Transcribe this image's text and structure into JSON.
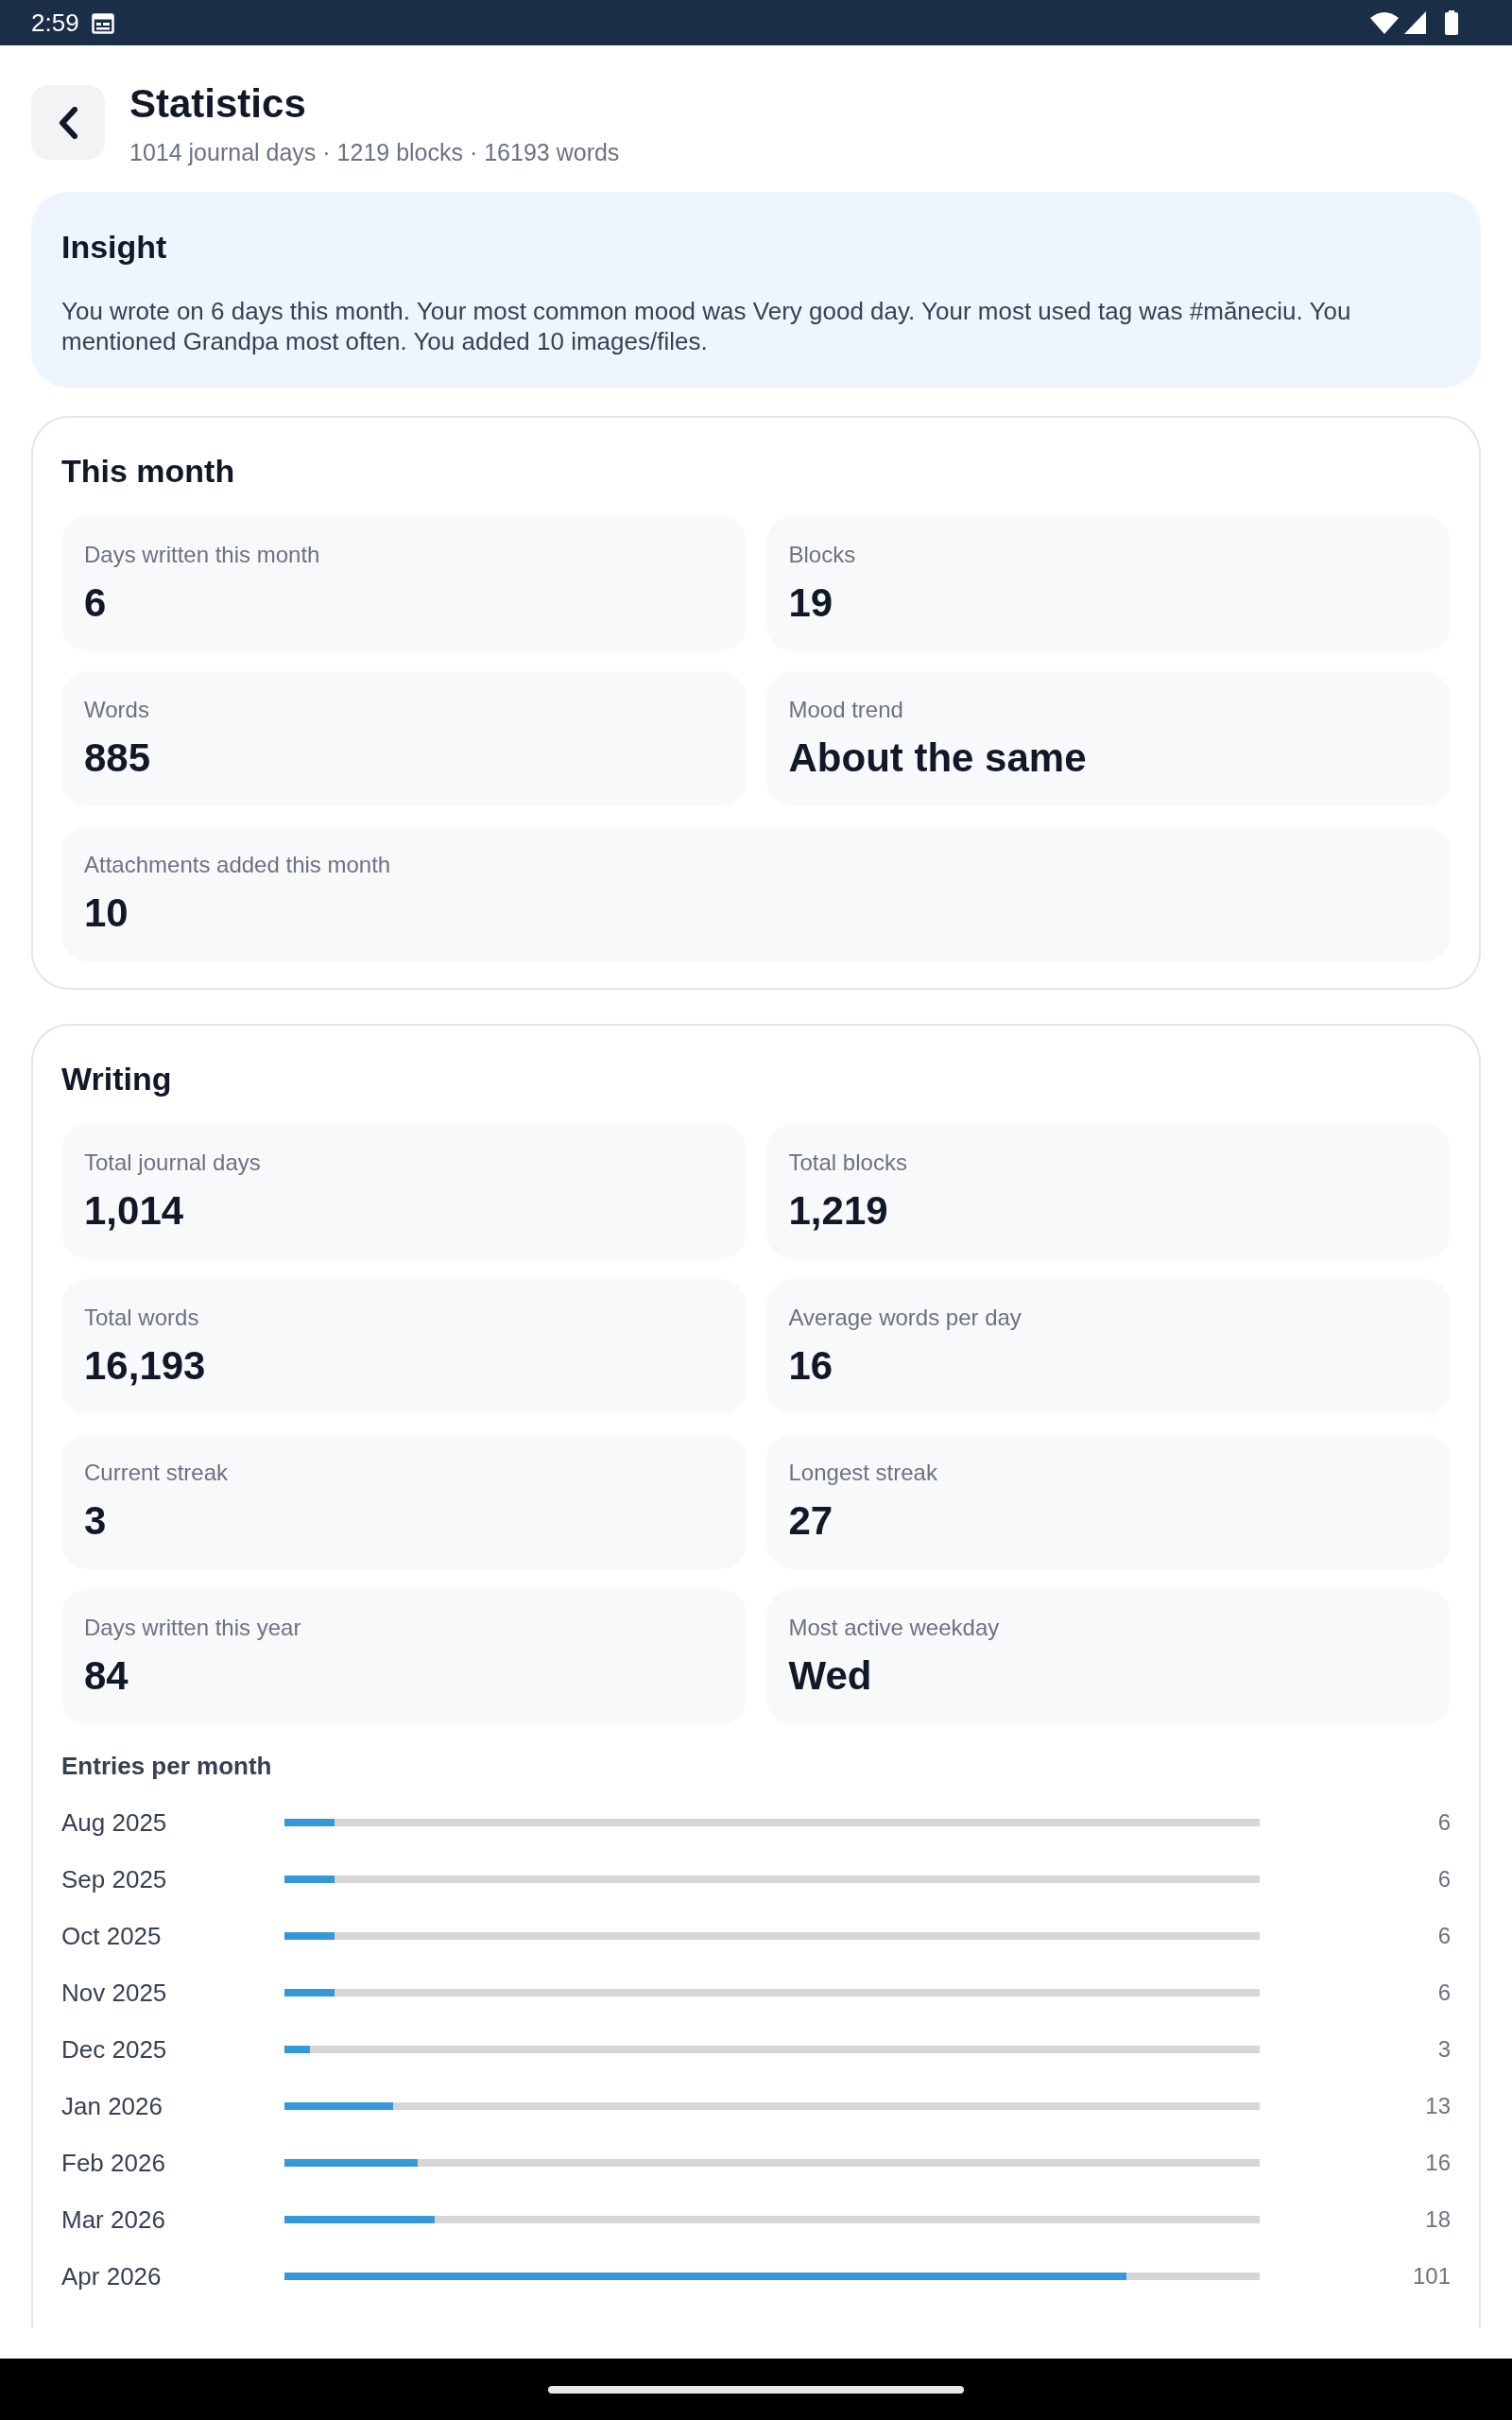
{
  "status_bar": {
    "time": "2:59"
  },
  "header": {
    "title": "Statistics",
    "subtitle": "1014 journal days · 1219 blocks · 16193 words"
  },
  "insight": {
    "title": "Insight",
    "text": "You wrote on 6 days this month. Your most common mood was Very good day. Your most used tag was #măneciu. You mentioned Grandpa most often. You added 10 images/files."
  },
  "sections": [
    {
      "title": "This month",
      "stats": [
        {
          "label": "Days written this month",
          "value": "6"
        },
        {
          "label": "Blocks",
          "value": "19"
        },
        {
          "label": "Words",
          "value": "885"
        },
        {
          "label": "Mood trend",
          "value": "About the same"
        },
        {
          "label": "Attachments added this month",
          "value": "10"
        }
      ]
    },
    {
      "title": "Writing",
      "stats": [
        {
          "label": "Total journal days",
          "value": "1,014"
        },
        {
          "label": "Total blocks",
          "value": "1,219"
        },
        {
          "label": "Total words",
          "value": "16,193"
        },
        {
          "label": "Average words per day",
          "value": "16"
        },
        {
          "label": "Current streak",
          "value": "3"
        },
        {
          "label": "Longest streak",
          "value": "27"
        },
        {
          "label": "Days written this year",
          "value": "84"
        },
        {
          "label": "Most active weekday",
          "value": "Wed"
        }
      ],
      "entries_per_month": {
        "title": "Entries per month",
        "rows": [
          {
            "month": "Aug 2025",
            "level": 0.051,
            "count": "6"
          },
          {
            "month": "Sep 2025",
            "level": 0.051,
            "count": "6"
          },
          {
            "month": "Oct 2025",
            "level": 0.051,
            "count": "6"
          },
          {
            "month": "Nov 2025",
            "level": 0.051,
            "count": "6"
          },
          {
            "month": "Dec 2025",
            "level": 0.026,
            "count": "3"
          },
          {
            "month": "Jan 2026",
            "level": 0.111,
            "count": "13"
          },
          {
            "month": "Feb 2026",
            "level": 0.137,
            "count": "16"
          },
          {
            "month": "Mar 2026",
            "level": 0.154,
            "count": "18"
          },
          {
            "month": "Apr 2026",
            "level": 0.863,
            "count": "101"
          }
        ]
      }
    }
  ]
}
